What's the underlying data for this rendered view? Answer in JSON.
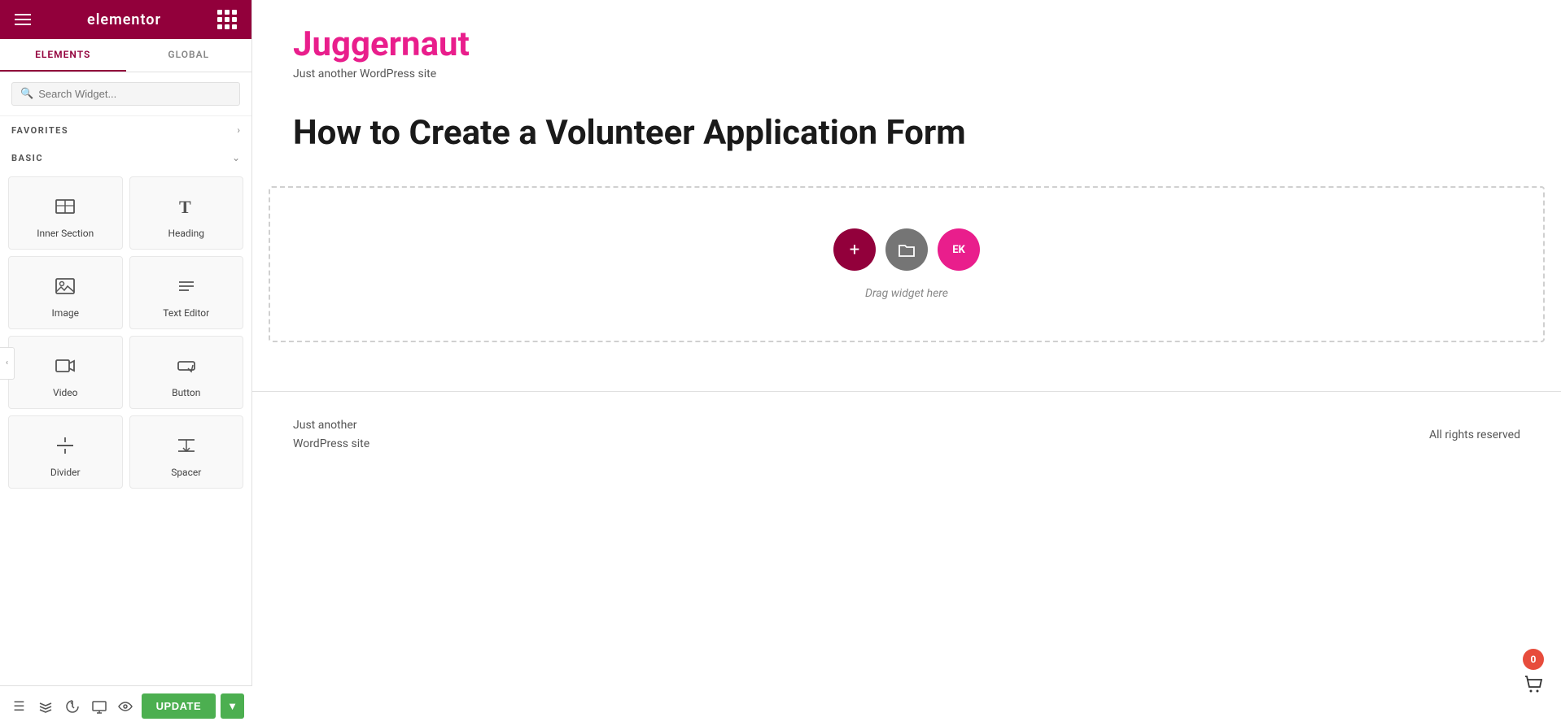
{
  "panel": {
    "logo": "elementor",
    "tabs": [
      {
        "id": "elements",
        "label": "ELEMENTS",
        "active": true
      },
      {
        "id": "global",
        "label": "GLOBAL",
        "active": false
      }
    ],
    "search": {
      "placeholder": "Search Widget..."
    },
    "sections": [
      {
        "id": "favorites",
        "label": "FAVORITES",
        "collapsed": true,
        "widgets": []
      },
      {
        "id": "basic",
        "label": "BASIC",
        "collapsed": false,
        "widgets": [
          {
            "id": "inner-section",
            "label": "Inner Section",
            "icon": "inner-section-icon"
          },
          {
            "id": "heading",
            "label": "Heading",
            "icon": "heading-icon"
          },
          {
            "id": "image",
            "label": "Image",
            "icon": "image-icon"
          },
          {
            "id": "text-editor",
            "label": "Text Editor",
            "icon": "text-editor-icon"
          },
          {
            "id": "video",
            "label": "Video",
            "icon": "video-icon"
          },
          {
            "id": "button",
            "label": "Button",
            "icon": "button-icon"
          },
          {
            "id": "divider",
            "label": "Divider",
            "icon": "divider-icon"
          },
          {
            "id": "spacer",
            "label": "Spacer",
            "icon": "spacer-icon"
          }
        ]
      }
    ],
    "bottom_bar": {
      "update_label": "UPDATE"
    }
  },
  "site": {
    "brand_title": "Juggernaut",
    "brand_tagline": "Just another WordPress site",
    "post_title": "How to Create a Volunteer Application Form",
    "drop_zone_label": "Drag widget here",
    "footer": {
      "left_text": "Just another\nWordPress site",
      "right_text": "All rights reserved"
    },
    "cart_count": "0"
  },
  "colors": {
    "brand": "#92003b",
    "pink": "#e91e8c",
    "green": "#4caf50",
    "gray": "#757575"
  }
}
